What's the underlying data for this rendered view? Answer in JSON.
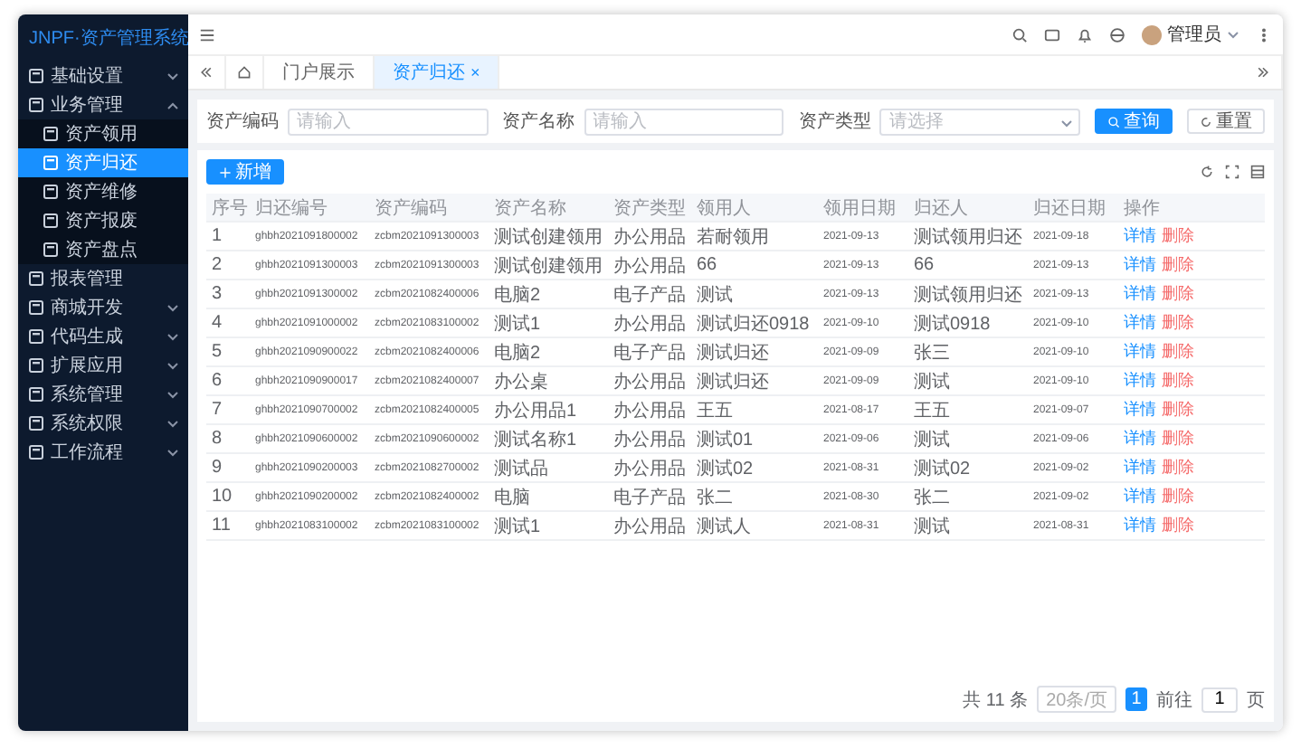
{
  "sidebar": {
    "logo": "JNPF",
    "title": "·资产管理系统",
    "items": [
      {
        "label": "基础设置",
        "selected": false,
        "expanded": false
      },
      {
        "label": "业务管理",
        "selected": false,
        "expanded": true,
        "children": [
          {
            "label": "资产领用",
            "selected": false
          },
          {
            "label": "资产归还",
            "selected": true
          },
          {
            "label": "资产维修",
            "selected": false
          },
          {
            "label": "资产报废",
            "selected": false
          },
          {
            "label": "资产盘点",
            "selected": false
          }
        ]
      },
      {
        "label": "报表管理",
        "selected": false
      },
      {
        "label": "商城开发",
        "selected": false,
        "expanded": false
      },
      {
        "label": "代码生成",
        "selected": false,
        "expanded": false
      },
      {
        "label": "扩展应用",
        "selected": false,
        "expanded": false
      },
      {
        "label": "系统管理",
        "selected": false,
        "expanded": false
      },
      {
        "label": "系统权限",
        "selected": false,
        "expanded": false
      },
      {
        "label": "工作流程",
        "selected": false,
        "expanded": false
      }
    ]
  },
  "header": {
    "user": "管理员"
  },
  "tabs": [
    {
      "label": "门户展示",
      "selected": false,
      "closable": false
    },
    {
      "label": "资产归还",
      "selected": true,
      "closable": true
    }
  ],
  "close_glyph": "×",
  "search": {
    "fields": [
      {
        "label": "资产编码",
        "placeholder": "请输入",
        "kind": "input"
      },
      {
        "label": "资产名称",
        "placeholder": "请输入",
        "kind": "input"
      },
      {
        "label": "资产类型",
        "placeholder": "请选择",
        "kind": "select"
      }
    ],
    "query_button": "查询",
    "reset_button": "重置"
  },
  "add_button": "新增",
  "table": {
    "columns": [
      "序号",
      "归还编号",
      "资产编码",
      "资产名称",
      "资产类型",
      "领用人",
      "领用日期",
      "归还人",
      "归还日期",
      "操作"
    ],
    "rows": [
      [
        "1",
        "ghbh2021091800002",
        "zcbm2021091300003",
        "测试创建领用",
        "办公用品",
        "若耐领用",
        "2021-09-13",
        "测试领用归还",
        "2021-09-18"
      ],
      [
        "2",
        "ghbh2021091300003",
        "zcbm2021091300003",
        "测试创建领用",
        "办公用品",
        "66",
        "2021-09-13",
        "66",
        "2021-09-13"
      ],
      [
        "3",
        "ghbh2021091300002",
        "zcbm2021082400006",
        "电脑2",
        "电子产品",
        "测试",
        "2021-09-13",
        "测试领用归还",
        "2021-09-13"
      ],
      [
        "4",
        "ghbh2021091000002",
        "zcbm2021083100002",
        "测试1",
        "办公用品",
        "测试归还0918",
        "2021-09-10",
        "测试0918",
        "2021-09-10"
      ],
      [
        "5",
        "ghbh2021090900022",
        "zcbm2021082400006",
        "电脑2",
        "电子产品",
        "测试归还",
        "2021-09-09",
        "张三",
        "2021-09-10"
      ],
      [
        "6",
        "ghbh2021090900017",
        "zcbm2021082400007",
        "办公桌",
        "办公用品",
        "测试归还",
        "2021-09-09",
        "测试",
        "2021-09-10"
      ],
      [
        "7",
        "ghbh2021090700002",
        "zcbm2021082400005",
        "办公用品1",
        "办公用品",
        "王五",
        "2021-08-17",
        "王五",
        "2021-09-07"
      ],
      [
        "8",
        "ghbh2021090600002",
        "zcbm2021090600002",
        "测试名称1",
        "办公用品",
        "测试01",
        "2021-09-06",
        "测试",
        "2021-09-06"
      ],
      [
        "9",
        "ghbh2021090200003",
        "zcbm2021082700002",
        "测试品",
        "办公用品",
        "测试02",
        "2021-08-31",
        "测试02",
        "2021-09-02"
      ],
      [
        "10",
        "ghbh2021090200002",
        "zcbm2021082400002",
        "电脑",
        "电子产品",
        "张二",
        "2021-08-30",
        "张二",
        "2021-09-02"
      ],
      [
        "11",
        "ghbh2021083100002",
        "zcbm2021083100002",
        "测试1",
        "办公用品",
        "测试人",
        "2021-08-31",
        "测试",
        "2021-08-31"
      ]
    ],
    "actions": [
      [
        "详情",
        "删除"
      ],
      [
        "详情",
        "删除"
      ],
      [
        "详情",
        "删除"
      ],
      [
        "详情",
        "删除"
      ],
      [
        "详情",
        "删除"
      ],
      [
        "详情",
        "删除"
      ],
      [
        "详情",
        "删除"
      ],
      [
        "详情",
        "删除"
      ],
      [
        "详情",
        "删除"
      ],
      [
        "详情",
        "删除"
      ],
      [
        "详情",
        "删除"
      ]
    ]
  },
  "pagination": {
    "total": "共 11 条",
    "page_size": "20条/页",
    "pages": [
      {
        "label": "1",
        "selected": true
      }
    ],
    "goto_label": "前往",
    "goto_value": "1",
    "goto_suffix": "页"
  }
}
